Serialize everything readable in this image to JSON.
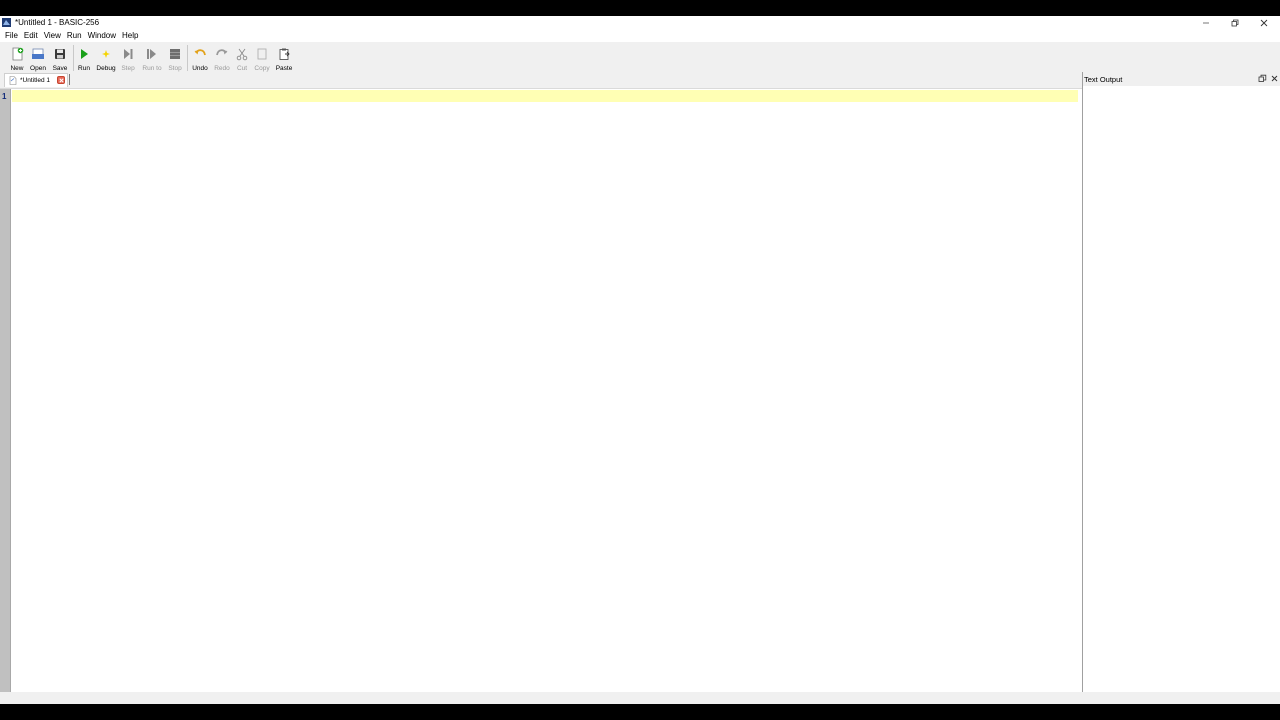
{
  "window": {
    "title": "*Untitled 1 - BASIC-256",
    "controls": {
      "minimize_icon": "minimize-icon",
      "restore_icon": "restore-icon",
      "close_icon": "close-icon"
    }
  },
  "menu": [
    "File",
    "Edit",
    "View",
    "Run",
    "Window",
    "Help"
  ],
  "toolbar": {
    "new": {
      "label": "New",
      "icon": "new-file-icon",
      "enabled": true
    },
    "open": {
      "label": "Open",
      "icon": "open-folder-icon",
      "enabled": true
    },
    "save": {
      "label": "Save",
      "icon": "save-disk-icon",
      "enabled": true
    },
    "run": {
      "label": "Run",
      "icon": "play-icon",
      "enabled": true
    },
    "debug": {
      "label": "Debug",
      "icon": "debug-spark-icon",
      "enabled": true
    },
    "step": {
      "label": "Step",
      "icon": "step-icon",
      "enabled": false
    },
    "runto": {
      "label": "Run to",
      "icon": "run-to-icon",
      "enabled": false
    },
    "stop": {
      "label": "Stop",
      "icon": "stop-icon",
      "enabled": false
    },
    "undo": {
      "label": "Undo",
      "icon": "undo-icon",
      "enabled": true
    },
    "redo": {
      "label": "Redo",
      "icon": "redo-icon",
      "enabled": false
    },
    "cut": {
      "label": "Cut",
      "icon": "scissors-icon",
      "enabled": false
    },
    "copy": {
      "label": "Copy",
      "icon": "copy-icon",
      "enabled": false
    },
    "paste": {
      "label": "Paste",
      "icon": "paste-icon",
      "enabled": true
    }
  },
  "editor": {
    "tab_label": "*Untitled 1",
    "line_numbers": [
      "1"
    ],
    "content": ""
  },
  "output_dock": {
    "title": "Text Output"
  },
  "colors": {
    "current_line": "#ffffb4",
    "gutter": "#c0c0c0",
    "run_green": "#1aa01a",
    "debug_yellow": "#f5d400",
    "disabled_text": "#9a9a9a"
  }
}
